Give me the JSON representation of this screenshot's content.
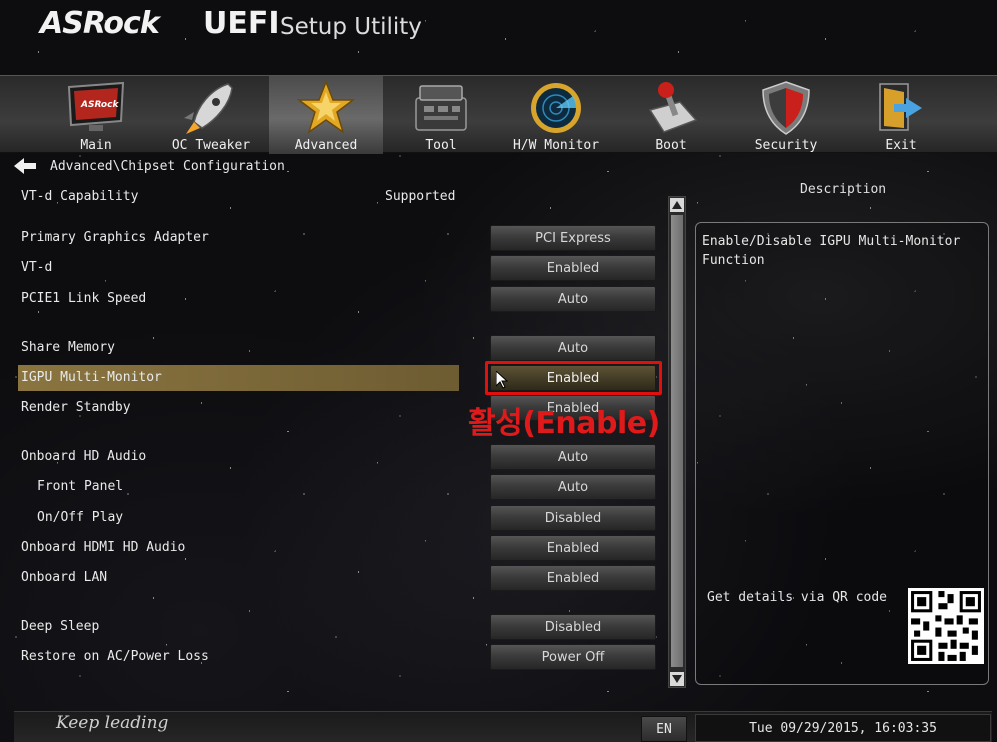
{
  "header": {
    "brand": "ASRock",
    "product": "UEFI",
    "subtitle": "Setup Utility"
  },
  "tabs": [
    {
      "label": "Main",
      "icon": "monitor-icon"
    },
    {
      "label": "OC Tweaker",
      "icon": "rocket-icon"
    },
    {
      "label": "Advanced",
      "icon": "star-icon",
      "active": true
    },
    {
      "label": "Tool",
      "icon": "toolbox-icon"
    },
    {
      "label": "H/W Monitor",
      "icon": "radar-icon"
    },
    {
      "label": "Boot",
      "icon": "joystick-icon"
    },
    {
      "label": "Security",
      "icon": "shield-icon"
    },
    {
      "label": "Exit",
      "icon": "exit-door-icon"
    }
  ],
  "breadcrumb": "Advanced\\Chipset Configuration",
  "settings": {
    "vtd_capability": {
      "label": "VT-d Capability",
      "value": "Supported"
    },
    "primary_graphics": {
      "label": "Primary Graphics Adapter",
      "value": "PCI Express"
    },
    "vtd": {
      "label": "VT-d",
      "value": "Enabled"
    },
    "pcie1_link": {
      "label": "PCIE1 Link Speed",
      "value": "Auto"
    },
    "share_memory": {
      "label": "Share Memory",
      "value": "Auto"
    },
    "igpu_multi": {
      "label": "IGPU Multi-Monitor",
      "value": "Enabled"
    },
    "render_standby": {
      "label": "Render Standby",
      "value": "Enabled"
    },
    "onboard_hd_audio": {
      "label": "Onboard HD Audio",
      "value": "Auto"
    },
    "front_panel": {
      "label": "Front Panel",
      "value": "Auto"
    },
    "onoff_play": {
      "label": "On/Off Play",
      "value": "Disabled"
    },
    "onboard_hdmi": {
      "label": "Onboard HDMI HD Audio",
      "value": "Enabled"
    },
    "onboard_lan": {
      "label": "Onboard LAN",
      "value": "Enabled"
    },
    "deep_sleep": {
      "label": "Deep Sleep",
      "value": "Disabled"
    },
    "restore_ac": {
      "label": "Restore on AC/Power Loss",
      "value": "Power Off"
    }
  },
  "annotation": "활성(Enable)",
  "description": {
    "title": "Description",
    "text": "Enable/Disable IGPU Multi-Monitor Function",
    "qr_label": "Get details via QR code"
  },
  "footer": {
    "tagline": "Keep leading",
    "language": "EN",
    "datetime": "Tue 09/29/2015, 16:03:35"
  },
  "colors": {
    "highlight": "#8a7540",
    "annotation_red": "#e01a1a"
  }
}
